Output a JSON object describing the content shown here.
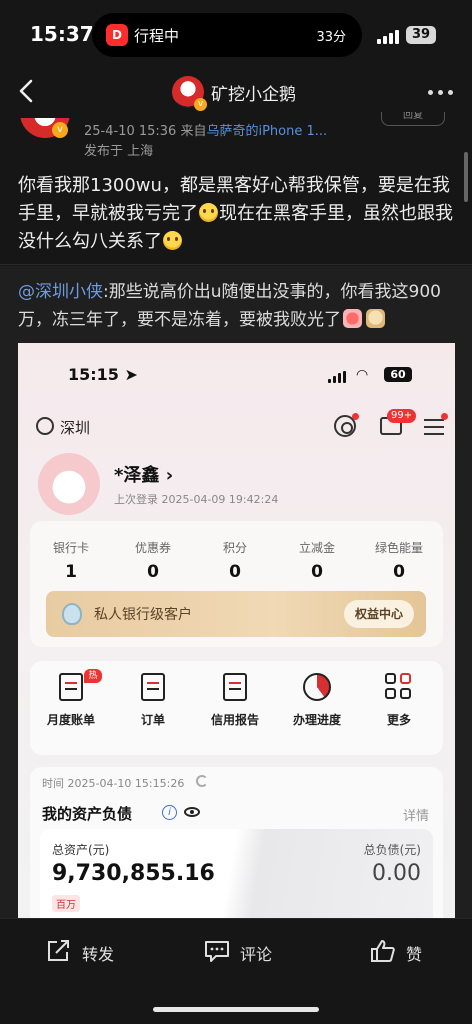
{
  "status_bar": {
    "time": "15:37",
    "live_activity_app": "行程中",
    "live_activity_right": "33分",
    "battery": "39"
  },
  "header": {
    "title": "矿挖小企鹅"
  },
  "post_meta": {
    "line1_prefix": "25-4-10 15:36  来自",
    "line1_source": "乌萨奇的iPhone 1...",
    "line2": "发布于 上海",
    "follow_label": "回复"
  },
  "post": {
    "text_part1": "你看我那1300wu，都是黑客好心帮我保管，要是在我手里，早就被我亏完了",
    "text_part2": "现在在黑客手里，虽然也跟我没什么勾八关系了"
  },
  "repost": {
    "mention": "@深圳小侠",
    "text": ":那些说高价出u随便出没事的，你看我这900万，冻三年了，要不是冻着，要被我败光了"
  },
  "screenshot": {
    "time": "15:15",
    "battery": "60",
    "location": "深圳",
    "msg_badge": "99+",
    "user_name": "*泽鑫",
    "last_login": "上次登录 2025-04-09 19:42:24",
    "stats": [
      {
        "label": "银行卡",
        "value": "1"
      },
      {
        "label": "优惠券",
        "value": "0"
      },
      {
        "label": "积分",
        "value": "0"
      },
      {
        "label": "立减金",
        "value": "0"
      },
      {
        "label": "绿色能量",
        "value": "0"
      }
    ],
    "vip_label": "私人银行级客户",
    "vip_button": "权益中心",
    "grid": [
      {
        "label": "月度账单",
        "icon": "monthly-bill-icon",
        "badge": "热"
      },
      {
        "label": "订单",
        "icon": "order-icon"
      },
      {
        "label": "信用报告",
        "icon": "credit-report-icon"
      },
      {
        "label": "办理进度",
        "icon": "progress-icon"
      },
      {
        "label": "更多",
        "icon": "more-grid-icon"
      }
    ],
    "assets": {
      "time": "时间 2025-04-10 15:15:26",
      "title": "我的资产负债",
      "detail": "详情",
      "total_assets_label": "总资产(元)",
      "total_assets_value": "9,730,855.16",
      "unit_tag": "百万",
      "total_debt_label": "总负债(元)",
      "total_debt_value": "0.00"
    }
  },
  "actions": {
    "repost": "转发",
    "comment": "评论",
    "like": "赞"
  }
}
